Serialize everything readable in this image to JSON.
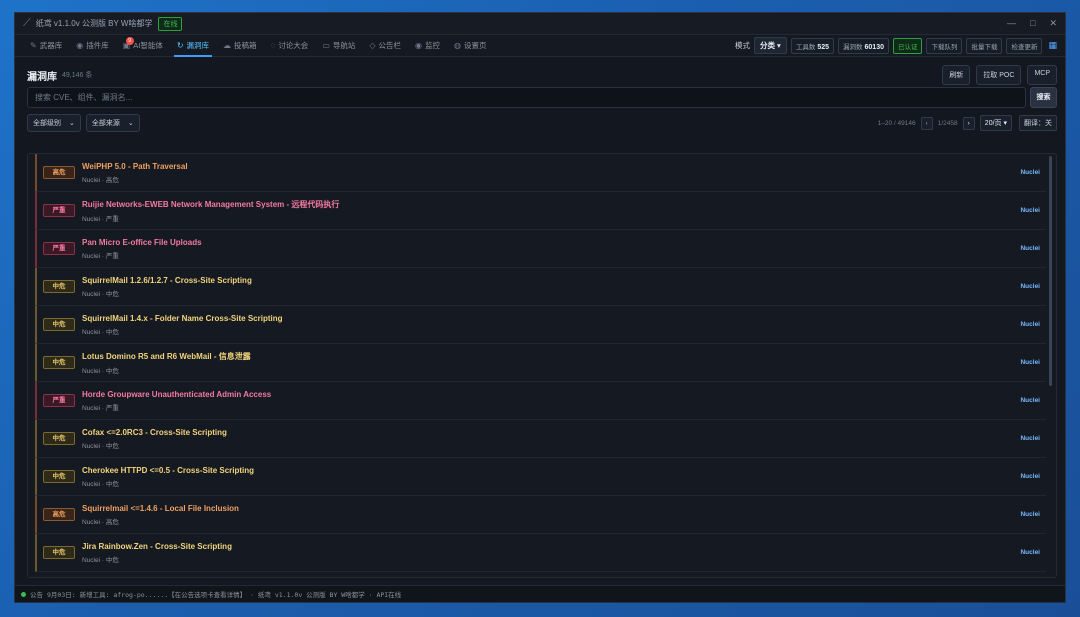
{
  "window": {
    "title": "纸鸢 v1.1.0v 公测版 BY W啥都学",
    "status_badge": "在线",
    "controls": [
      "—",
      "□",
      "✕"
    ]
  },
  "tabs": [
    {
      "label": "武器库",
      "icon": "✎"
    },
    {
      "label": "插件库",
      "icon": "◉"
    },
    {
      "label": "AI智能体",
      "icon": "▣",
      "badge": "9"
    },
    {
      "label": "漏洞库",
      "icon": "↻",
      "active": true
    },
    {
      "label": "投稿箱",
      "icon": "☁"
    },
    {
      "label": "讨论大会",
      "icon": "◌"
    },
    {
      "label": "导航站",
      "icon": "▭"
    },
    {
      "label": "公告栏",
      "icon": "◇"
    },
    {
      "label": "监控",
      "icon": "◉"
    },
    {
      "label": "设置页",
      "icon": "◍"
    }
  ],
  "toolbar": {
    "mode_label": "模式",
    "mode_value": "分类 ▾",
    "tools_label": "工具数",
    "tools_value": "525",
    "vulns_label": "漏洞数",
    "vulns_value": "60130",
    "auth_status": "已认证",
    "download_queue": "下载队列",
    "batch_download": "批量下载",
    "check_updates": "检查更新"
  },
  "panel": {
    "title": "漏洞库",
    "count": "49,146 条",
    "refresh": "刷新",
    "fetch_poc": "拉取 POC",
    "mcp": "MCP",
    "search_placeholder": "搜索 CVE、组件、漏洞名...",
    "search_button": "搜索",
    "filter_level": "全部级别",
    "filter_source": "全部来源",
    "range": "1–20 / 49146",
    "prev": "‹",
    "page": "1/2458",
    "next": "›",
    "page_size": "20/页 ▾",
    "translate": "翻译：关"
  },
  "rows": [
    {
      "severity": "high",
      "badge": "高危",
      "name": "WeiPHP 5.0 - Path Traversal",
      "meta": "Nuclei · 高危",
      "source": "Nuclei"
    },
    {
      "severity": "critical",
      "badge": "严重",
      "name": "Ruijie Networks-EWEB Network Management System - 远程代码执行",
      "meta": "Nuclei · 严重",
      "source": "Nuclei"
    },
    {
      "severity": "critical",
      "badge": "严重",
      "name": "Pan Micro E-office File Uploads",
      "meta": "Nuclei · 严重",
      "source": "Nuclei"
    },
    {
      "severity": "medium",
      "badge": "中危",
      "name": "SquirrelMail 1.2.6/1.2.7 - Cross-Site Scripting",
      "meta": "Nuclei · 中危",
      "source": "Nuclei"
    },
    {
      "severity": "medium",
      "badge": "中危",
      "name": "SquirrelMail 1.4.x - Folder Name Cross-Site Scripting",
      "meta": "Nuclei · 中危",
      "source": "Nuclei"
    },
    {
      "severity": "medium",
      "badge": "中危",
      "name": "Lotus Domino R5 and R6 WebMail - 信息泄露",
      "meta": "Nuclei · 中危",
      "source": "Nuclei"
    },
    {
      "severity": "critical",
      "badge": "严重",
      "name": "Horde Groupware Unauthenticated Admin Access",
      "meta": "Nuclei · 严重",
      "source": "Nuclei"
    },
    {
      "severity": "medium",
      "badge": "中危",
      "name": "Cofax <=2.0RC3 - Cross-Site Scripting",
      "meta": "Nuclei · 中危",
      "source": "Nuclei"
    },
    {
      "severity": "medium",
      "badge": "中危",
      "name": "Cherokee HTTPD <=0.5 - Cross-Site Scripting",
      "meta": "Nuclei · 中危",
      "source": "Nuclei"
    },
    {
      "severity": "high",
      "badge": "高危",
      "name": "Squirrelmail <=1.4.6 - Local File Inclusion",
      "meta": "Nuclei · 高危",
      "source": "Nuclei"
    },
    {
      "severity": "medium",
      "badge": "中危",
      "name": "Jira Rainbow.Zen - Cross-Site Scripting",
      "meta": "Nuclei · 中危",
      "source": "Nuclei"
    }
  ],
  "statusbar": {
    "label": "公告",
    "text": "9月03日: 新增工具: afrog-po......【在公告选项卡查看详情】 · 纸鸢 v1.1.0v 公测版 BY W啥都学 · API在线"
  }
}
